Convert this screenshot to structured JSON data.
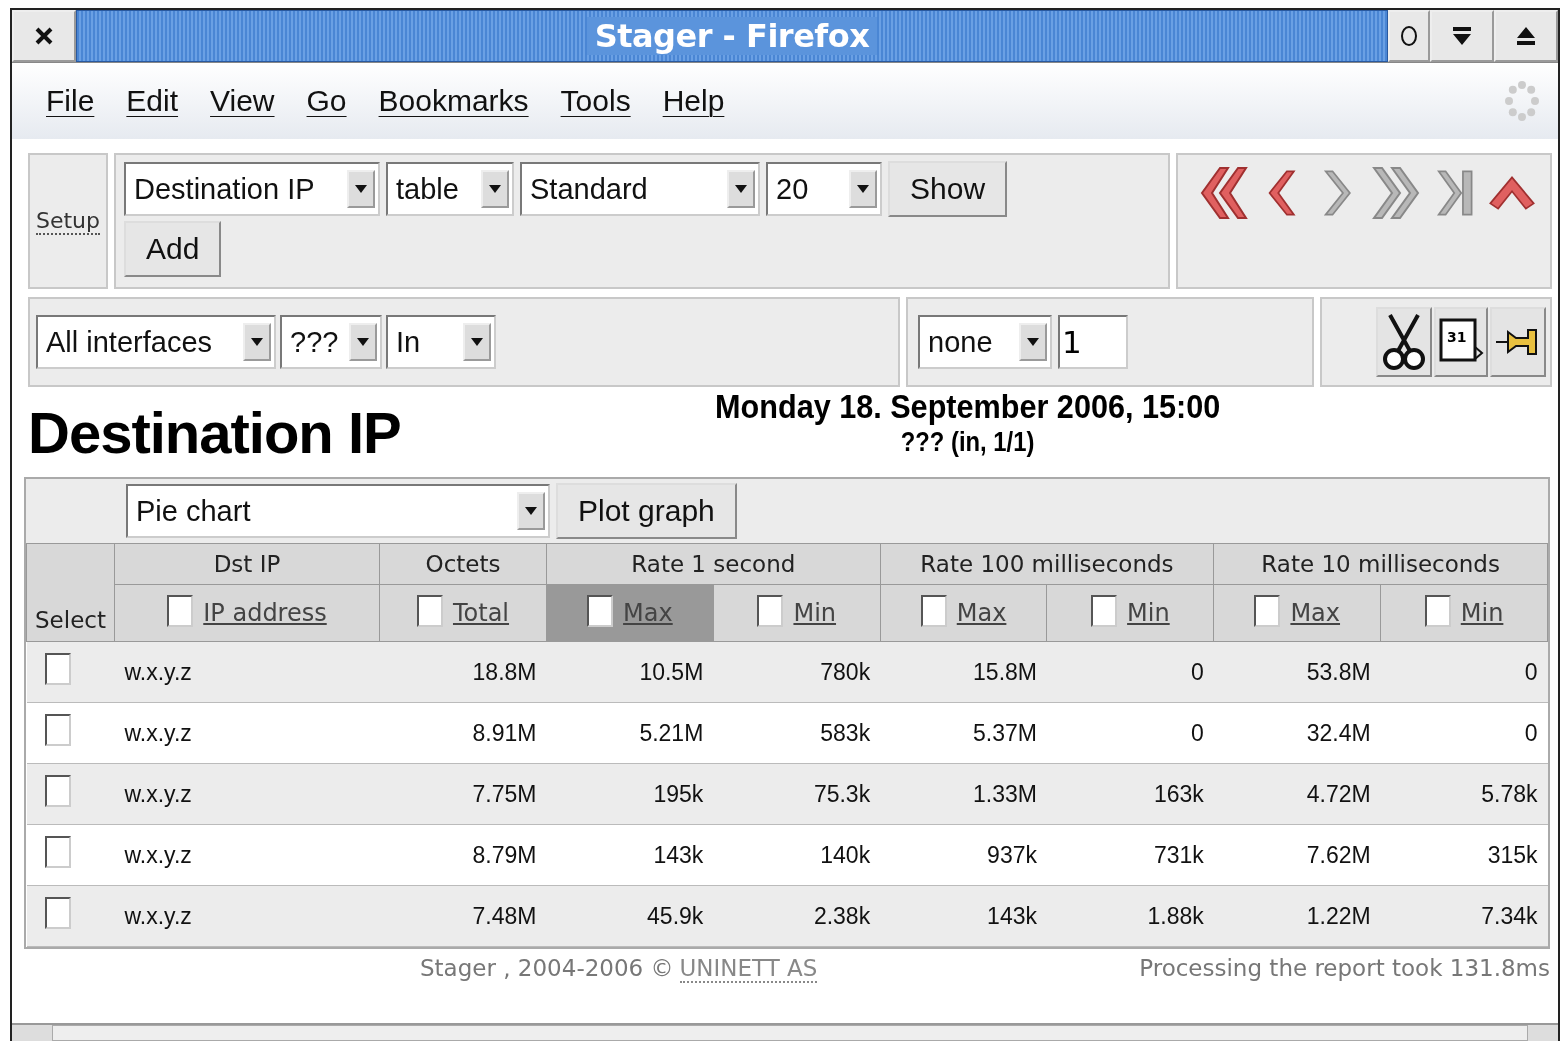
{
  "window": {
    "title": "Stager - Firefox"
  },
  "menu": [
    "File",
    "Edit",
    "View",
    "Go",
    "Bookmarks",
    "Tools",
    "Help"
  ],
  "setup": {
    "link": "Setup",
    "selects": [
      {
        "value": "Destination IP"
      },
      {
        "value": "table"
      },
      {
        "value": "Standard"
      },
      {
        "value": "20"
      }
    ],
    "show_button": "Show",
    "add_button": "Add"
  },
  "nav": [
    {
      "kind": "first",
      "disabled": false
    },
    {
      "kind": "prev",
      "disabled": false
    },
    {
      "kind": "next",
      "disabled": true
    },
    {
      "kind": "last",
      "disabled": true
    },
    {
      "kind": "end",
      "disabled": true
    },
    {
      "kind": "up",
      "disabled": false
    }
  ],
  "filters": {
    "selects": [
      {
        "value": "All interfaces"
      },
      {
        "value": "???"
      },
      {
        "value": "In"
      }
    ],
    "limit_select": "none",
    "limit_value": "1",
    "calendar_label": "31"
  },
  "heading": "Destination IP",
  "date": "Monday 18. September 2006, 15:00",
  "subtitle": "??? (in, 1/1)",
  "graph": {
    "select": "Pie chart",
    "button": "Plot graph"
  },
  "table": {
    "select_header": "Select",
    "groups": [
      {
        "label": "Dst IP",
        "columns": [
          {
            "label": "IP address",
            "checked": false,
            "selected": false
          }
        ]
      },
      {
        "label": "Octets",
        "columns": [
          {
            "label": "Total",
            "checked": false,
            "selected": false
          }
        ]
      },
      {
        "label": "Rate 1 second",
        "columns": [
          {
            "label": "Max",
            "checked": false,
            "selected": true
          },
          {
            "label": "Min",
            "checked": false,
            "selected": false
          }
        ]
      },
      {
        "label": "Rate 100 milliseconds",
        "columns": [
          {
            "label": "Max",
            "checked": false,
            "selected": false
          },
          {
            "label": "Min",
            "checked": false,
            "selected": false
          }
        ]
      },
      {
        "label": "Rate 10 milliseconds",
        "columns": [
          {
            "label": "Max",
            "checked": false,
            "selected": false
          },
          {
            "label": "Min",
            "checked": false,
            "selected": false
          }
        ]
      }
    ],
    "rows": [
      {
        "checked": false,
        "cells": [
          "w.x.y.z",
          "18.8M",
          "10.5M",
          "780k",
          "15.8M",
          "0",
          "53.8M",
          "0"
        ]
      },
      {
        "checked": false,
        "cells": [
          "w.x.y.z",
          "8.91M",
          "5.21M",
          "583k",
          "5.37M",
          "0",
          "32.4M",
          "0"
        ]
      },
      {
        "checked": false,
        "cells": [
          "w.x.y.z",
          "7.75M",
          "195k",
          "75.3k",
          "1.33M",
          "163k",
          "4.72M",
          "5.78k"
        ]
      },
      {
        "checked": false,
        "cells": [
          "w.x.y.z",
          "8.79M",
          "143k",
          "140k",
          "937k",
          "731k",
          "7.62M",
          "315k"
        ]
      },
      {
        "checked": false,
        "cells": [
          "w.x.y.z",
          "7.48M",
          "45.9k",
          "2.38k",
          "143k",
          "1.88k",
          "1.22M",
          "7.34k"
        ]
      }
    ]
  },
  "footer": {
    "credit": "Stager , 2004-2006 ©",
    "credit_link": "UNINETT AS",
    "timing": "Processing the report took 131.8ms"
  }
}
